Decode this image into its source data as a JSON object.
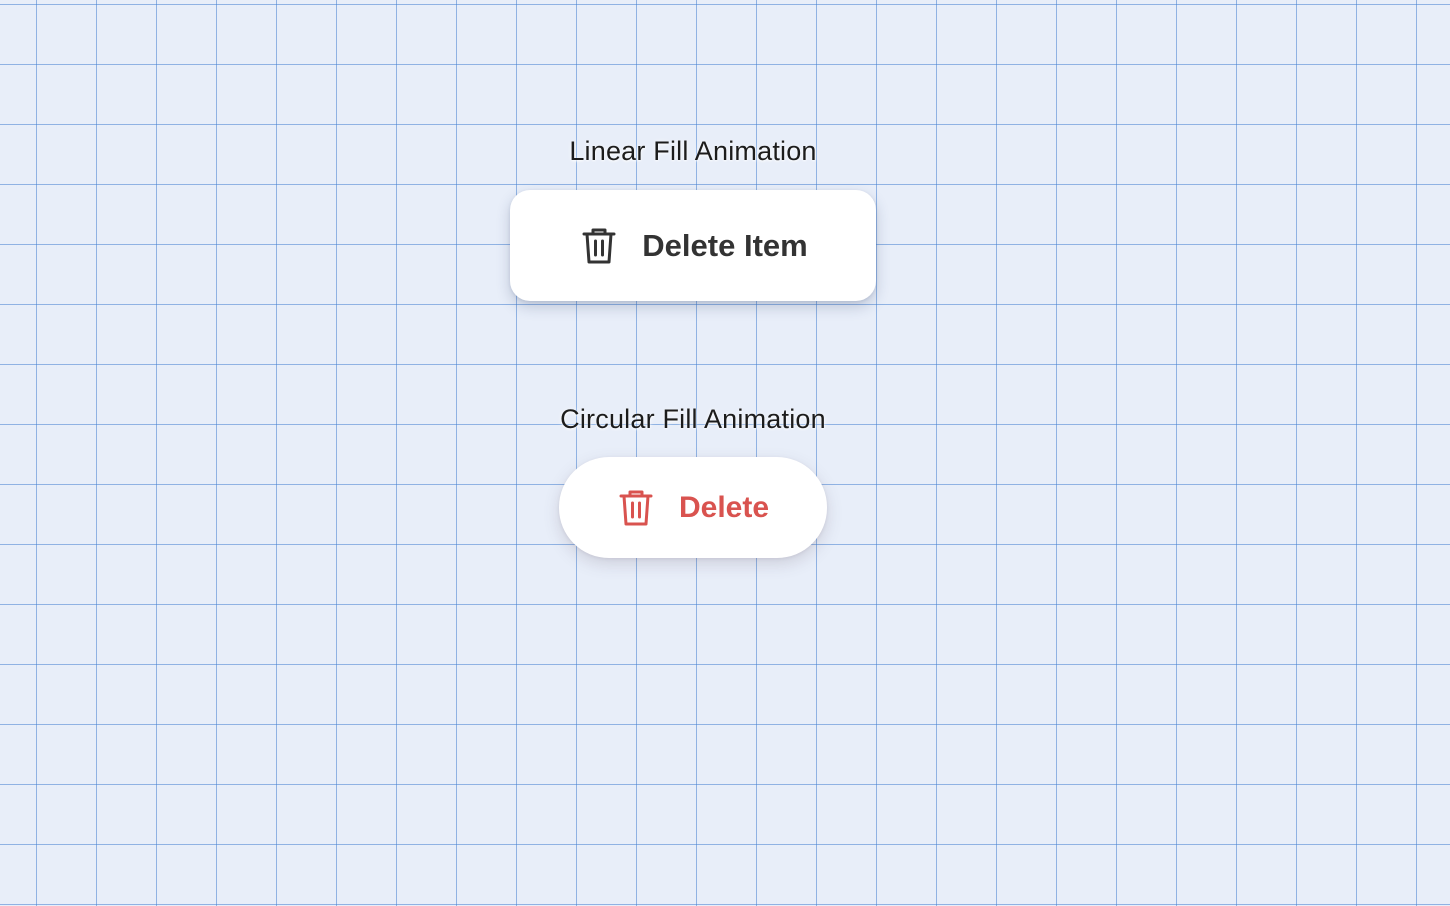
{
  "sections": [
    {
      "title": "Linear Fill Animation",
      "button": {
        "label": "Delete Item",
        "icon": "trash-icon",
        "color": "#333333"
      }
    },
    {
      "title": "Circular Fill Animation",
      "button": {
        "label": "Delete",
        "icon": "trash-icon",
        "color": "#d9534f"
      }
    }
  ],
  "background": {
    "color": "#e8eef9",
    "grid_color": "#4682d2"
  }
}
